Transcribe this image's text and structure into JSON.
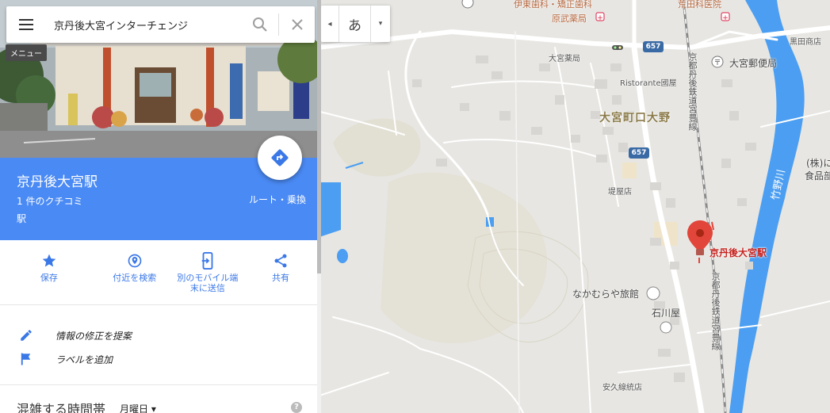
{
  "search": {
    "value": "京丹後大宮インターチェンジ",
    "menu_tooltip": "メニュー"
  },
  "ime": {
    "collapse_glyph": "◂",
    "lang_label": "あ",
    "dropdown_glyph": "▾"
  },
  "place": {
    "title": "京丹後大宮駅",
    "reviews": "1 件のクチコミ",
    "type": "駅",
    "route_label": "ルート・乗換"
  },
  "actions": [
    {
      "icon": "star-icon",
      "label": "保存"
    },
    {
      "icon": "nearby-icon",
      "label": "付近を検索"
    },
    {
      "icon": "send-to-device-icon",
      "label": "別のモバイル端\n末に送信"
    },
    {
      "icon": "share-icon",
      "label": "共有"
    }
  ],
  "suggestions": [
    {
      "icon": "pencil-icon",
      "label": "情報の修正を提案"
    },
    {
      "icon": "flag-icon",
      "label": "ラベルを追加"
    }
  ],
  "popular_times": {
    "title": "混雑する時間帯",
    "day": "月曜日",
    "day_arrow": "▾",
    "help": "?"
  },
  "map": {
    "labels": {
      "dental": "伊東歯科・矯正歯科",
      "pharmacy_hara": "原武薬局",
      "hospital": "荒田科医院",
      "kuroda": "黒田商店",
      "omiya_pharmacy": "大宮薬局",
      "ristorante": "Ristorante國屋",
      "post_office": "大宮郵便局",
      "area": "大宮町口大野",
      "katsura": "堤屋店",
      "rail_line_north": "京都丹後鉄道宮豊線",
      "rail_line_south": "京都丹後鉄道宮豊線",
      "station": "京丹後大宮駅",
      "nakamuraya": "なかむらや旅館",
      "ishikawaya": "石川屋",
      "yasukuni": "安久線統店",
      "shop_corp": "(株)に",
      "shop_food": "食品部・商",
      "river": "竹野川"
    },
    "route_numbers": [
      "657",
      "657"
    ],
    "colors": {
      "water": "#4b9ef1",
      "park": "#d7dcb8",
      "road": "#ffffff",
      "marker": "#e2453a",
      "rail": "#8a8a8a"
    }
  },
  "colors": {
    "accent": "#4a8af4",
    "action": "#3b78e7",
    "flag": "#3b78e7"
  }
}
